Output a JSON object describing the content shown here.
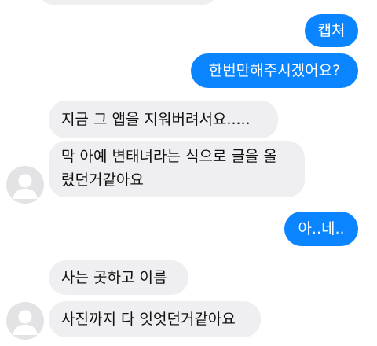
{
  "messages": {
    "out_1": "캡쳐",
    "out_2": "한번만해주시겠어요?",
    "in_1": "지금 그 앱을 지워버려서요.....",
    "in_2_line1": "막 아예 변태녀라는 식으로 글을 올",
    "in_2_line2": "렸던거같아요",
    "out_3": "아..네..",
    "in_3": "사는 곳하고 이름",
    "in_4": "사진까지 다 잇엇던거같아요"
  },
  "colors": {
    "outgoing_bubble": "#0a84ff",
    "incoming_bubble": "#efeff1",
    "avatar_bg": "#e8e8ea"
  },
  "icons": {
    "avatar": "default-user-avatar-icon"
  }
}
